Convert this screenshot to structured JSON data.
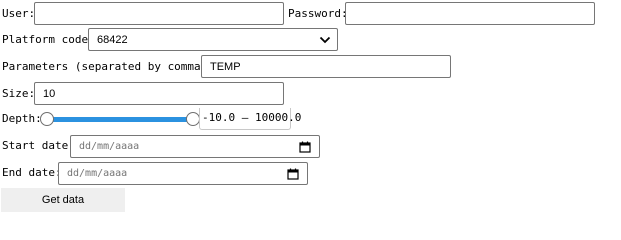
{
  "form": {
    "user": {
      "label": "User:",
      "value": ""
    },
    "password": {
      "label": "Password:",
      "value": ""
    },
    "platform_code": {
      "label": "Platform code:",
      "selected": "68422"
    },
    "parameters": {
      "label": "Parameters (separated by commas):",
      "value": "TEMP"
    },
    "size": {
      "label": "Size:",
      "value": "10"
    },
    "depth": {
      "label": "Depth:",
      "readout": "-10.0 – 10000.0",
      "min_fraction": 0.0,
      "max_fraction": 1.0
    },
    "start_date": {
      "label": "Start date:",
      "placeholder": "dd/mm/aaaa"
    },
    "end_date": {
      "label": "End date:",
      "placeholder": "dd/mm/aaaa"
    },
    "submit": {
      "label": "Get data"
    }
  },
  "icons": {
    "select_arrow": "chevron-down-icon",
    "date_picker": "calendar-icon"
  },
  "colors": {
    "slider_track": "#2b92e0",
    "button_bg": "#efefef",
    "placeholder": "#757575"
  }
}
